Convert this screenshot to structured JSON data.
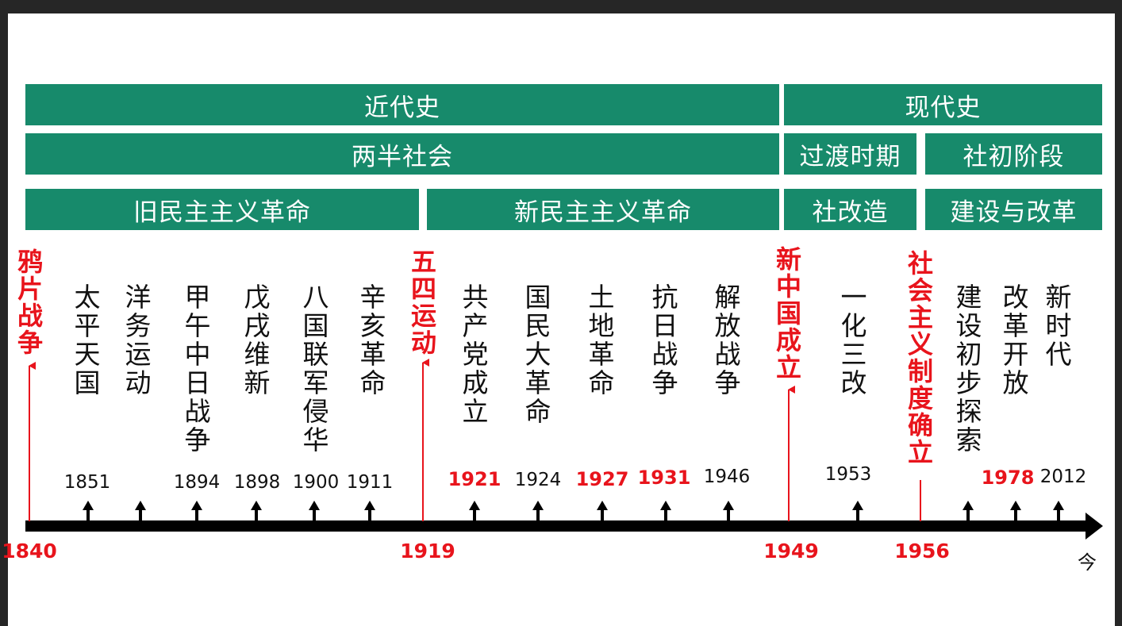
{
  "colors": {
    "band_green": "#178a6b",
    "accent_red": "#e8141c",
    "axis_black": "#000000"
  },
  "bands": {
    "row1": [
      "近代史",
      "现代史"
    ],
    "row2": [
      "两半社会",
      "过渡时期",
      "社初阶段"
    ],
    "row3": [
      "旧民主主义革命",
      "新民主主义革命",
      "社改造",
      "建设与改革"
    ]
  },
  "major_events": [
    {
      "label": "鸦片战争",
      "year": "1840"
    },
    {
      "label": "五四运动",
      "year": "1919"
    },
    {
      "label": "新中国成立",
      "year": "1949"
    },
    {
      "label": "社会主义制度确立",
      "year": "1956"
    }
  ],
  "events": [
    {
      "label": "太平天国",
      "year": "1851",
      "highlight": false
    },
    {
      "label": "洋务运动",
      "year": "",
      "highlight": false
    },
    {
      "label": "甲午中日战争",
      "year": "1894",
      "highlight": false
    },
    {
      "label": "戊戌维新",
      "year": "1898",
      "highlight": false
    },
    {
      "label": "八国联军侵华",
      "year": "1900",
      "highlight": false
    },
    {
      "label": "辛亥革命",
      "year": "1911",
      "highlight": false
    },
    {
      "label": "共产党成立",
      "year": "1921",
      "highlight": true
    },
    {
      "label": "国民大革命",
      "year": "1924",
      "highlight": false
    },
    {
      "label": "土地革命",
      "year": "1927",
      "highlight": true
    },
    {
      "label": "抗日战争",
      "year": "1931",
      "highlight": true
    },
    {
      "label": "解放战争",
      "year": "1946",
      "highlight": false
    },
    {
      "label": "一化三改",
      "year": "1953",
      "highlight": false
    },
    {
      "label": "建设初步探索",
      "year": "",
      "highlight": false
    },
    {
      "label": "改革开放",
      "year": "1978",
      "highlight": true
    },
    {
      "label": "新时代",
      "year": "2012",
      "highlight": false
    }
  ],
  "axis_end_label": "今"
}
